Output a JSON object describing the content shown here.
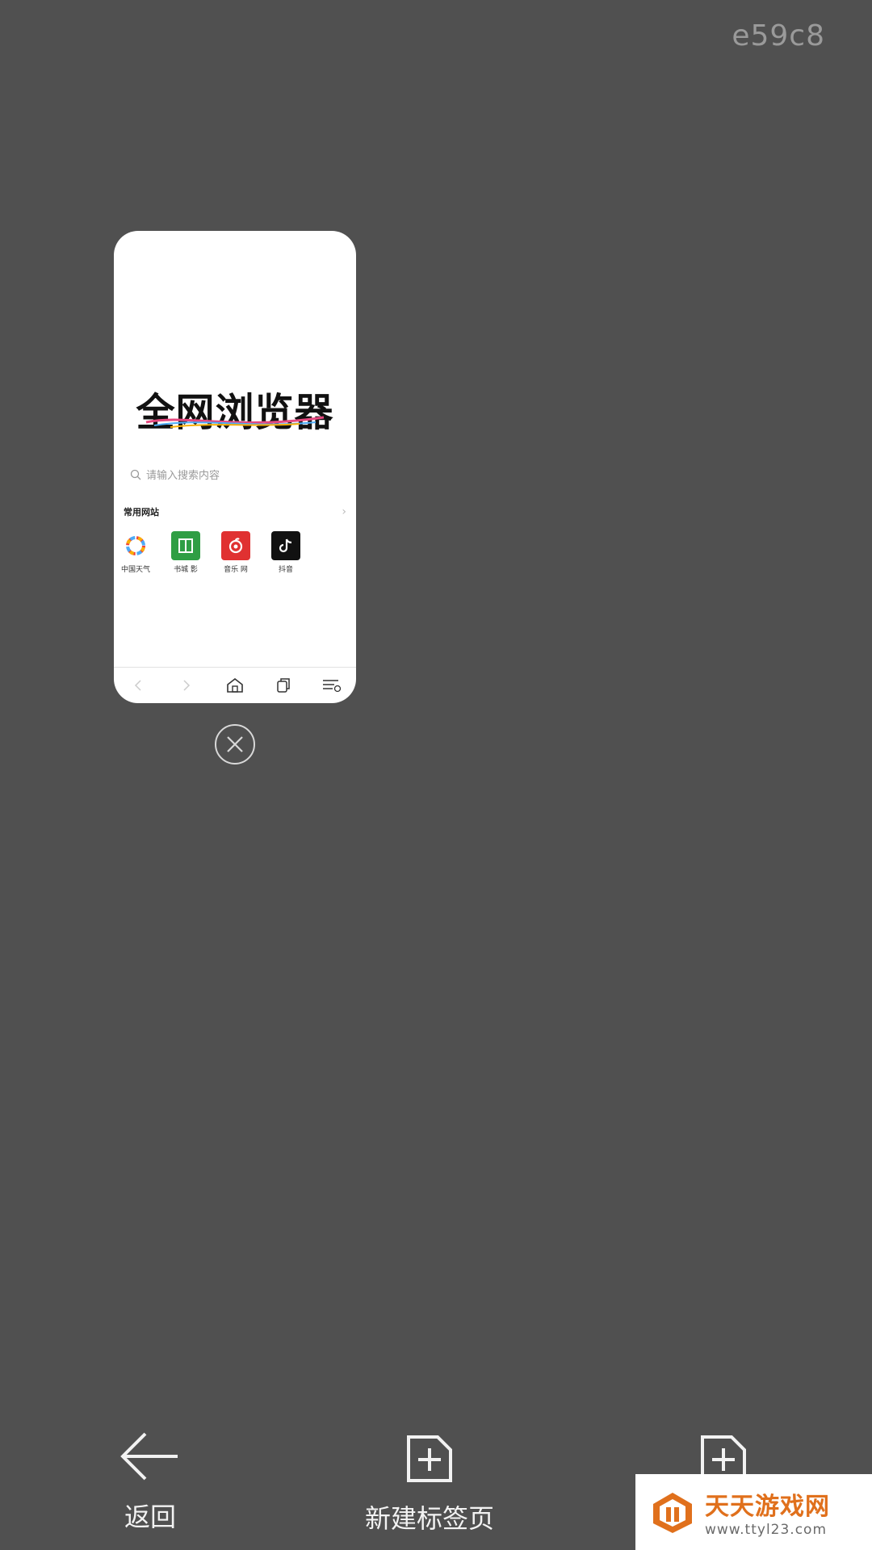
{
  "tab_id": "e59c8",
  "tab_preview": {
    "brand": "全网浏览器",
    "search_placeholder": "请输入搜索内容",
    "sites_title": "常用网站",
    "sites": [
      {
        "label": "中国天气",
        "icon": "weather-icon",
        "color": "#ffffff"
      },
      {
        "label": "书城 影",
        "icon": "book-icon",
        "color": "#2f9e44"
      },
      {
        "label": "音乐 网",
        "icon": "music-icon",
        "color": "#e03131"
      },
      {
        "label": "抖音",
        "icon": "tiktok-icon",
        "color": "#111111"
      }
    ]
  },
  "bottom": {
    "back_label": "返回",
    "new_tab_label": "新建标签页"
  },
  "watermark": {
    "title": "天天游戏网",
    "url": "www.ttyl23.com"
  },
  "colors": {
    "background": "#505050",
    "accent": "#e0701c"
  }
}
